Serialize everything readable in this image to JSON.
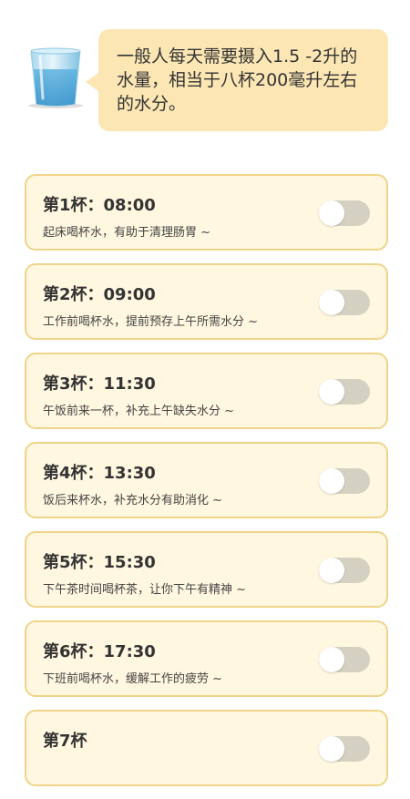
{
  "header": {
    "intro_text": "一般人每天需要摄入1.5 -2升的水量，相当于八杯200毫升左右的水分。"
  },
  "cups": [
    {
      "title": "第1杯：08:00",
      "desc": "起床喝杯水，有助于清理肠胃 ~",
      "enabled": false
    },
    {
      "title": "第2杯：09:00",
      "desc": "工作前喝杯水，提前预存上午所需水分 ~",
      "enabled": false
    },
    {
      "title": "第3杯：11:30",
      "desc": "午饭前来一杯，补充上午缺失水分 ~",
      "enabled": false
    },
    {
      "title": "第4杯：13:30",
      "desc": "饭后来杯水，补充水分有助消化 ~",
      "enabled": false
    },
    {
      "title": "第5杯：15:30",
      "desc": "下午茶时间喝杯茶，让你下午有精神 ~",
      "enabled": false
    },
    {
      "title": "第6杯：17:30",
      "desc": "下班前喝杯水，缓解工作的疲劳 ~",
      "enabled": false
    },
    {
      "title": "第7杯",
      "desc": "",
      "enabled": false
    }
  ],
  "colors": {
    "bubble": "#fbe6b4",
    "card_bg": "#fff7e0",
    "card_border": "#efd48a",
    "toggle_off": "#d4d1c2"
  },
  "icons": {
    "header_icon": "water-glass-icon"
  }
}
